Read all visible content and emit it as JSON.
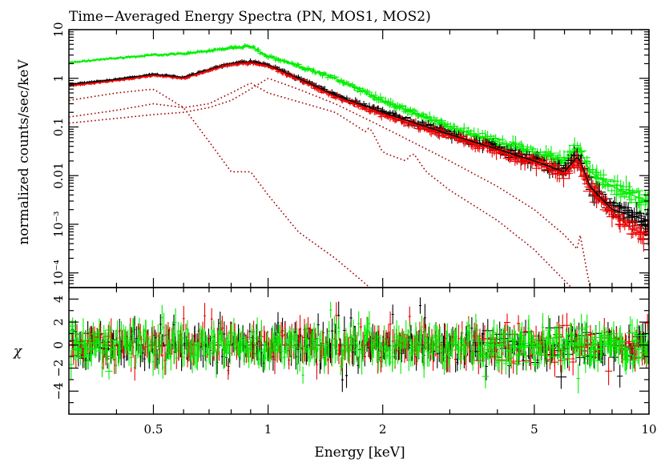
{
  "chart_data": [
    {
      "panel": "spectrum",
      "type": "scatter",
      "title": "Time−Averaged Energy Spectra (PN, MOS1, MOS2)",
      "xlabel": "Energy [keV]",
      "ylabel": "normalized counts/sec/keV",
      "xscale": "log",
      "yscale": "log",
      "xlim": [
        0.3,
        10
      ],
      "ylim": [
        5e-05,
        10
      ],
      "grid": false,
      "legend": "none",
      "x_ticks": [
        "0.5",
        "1",
        "2",
        "5",
        "10"
      ],
      "y_ticks": [
        "10⁻⁴",
        "10⁻³",
        "0.01",
        "0.1",
        "1",
        "10"
      ],
      "series": [
        {
          "color": "#00ee00",
          "style": "crosses",
          "x": [
            0.3,
            0.4,
            0.5,
            0.6,
            0.7,
            0.8,
            0.9,
            1.0,
            1.2,
            1.5,
            2.0,
            3.0,
            4.0,
            5.0,
            6.0,
            6.5,
            6.6,
            7.0,
            8.0,
            9.0,
            10.0
          ],
          "y": [
            2.1,
            2.6,
            3.0,
            3.2,
            3.7,
            4.3,
            4.6,
            2.8,
            1.8,
            1.0,
            0.35,
            0.1,
            0.05,
            0.03,
            0.02,
            0.04,
            0.035,
            0.012,
            0.006,
            0.004,
            0.003
          ]
        },
        {
          "color": "#000000",
          "style": "crosses",
          "x": [
            0.3,
            0.4,
            0.5,
            0.6,
            0.7,
            0.8,
            0.9,
            1.0,
            1.2,
            1.5,
            2.0,
            3.0,
            4.0,
            5.0,
            6.0,
            6.5,
            6.6,
            7.0,
            8.0,
            9.0,
            10.0
          ],
          "y": [
            0.75,
            0.95,
            1.2,
            1.05,
            1.5,
            2.0,
            2.2,
            1.9,
            1.0,
            0.45,
            0.2,
            0.07,
            0.035,
            0.02,
            0.012,
            0.025,
            0.02,
            0.006,
            0.002,
            0.0015,
            0.0012
          ]
        },
        {
          "color": "#ee0000",
          "style": "crosses",
          "x": [
            0.3,
            0.4,
            0.5,
            0.6,
            0.7,
            0.8,
            0.9,
            1.0,
            1.2,
            1.5,
            2.0,
            3.0,
            4.0,
            5.0,
            6.0,
            6.5,
            6.6,
            7.0,
            8.0,
            9.0,
            10.0
          ],
          "y": [
            0.7,
            0.9,
            1.15,
            1.0,
            1.45,
            1.95,
            2.1,
            1.8,
            0.95,
            0.42,
            0.18,
            0.065,
            0.032,
            0.018,
            0.011,
            0.022,
            0.018,
            0.005,
            0.0018,
            0.0008,
            0.0006
          ]
        },
        {
          "color": "#a80000",
          "style": "dotted",
          "component": 1,
          "x": [
            0.3,
            0.4,
            0.5,
            0.6,
            0.7,
            0.8,
            0.9,
            1.0,
            1.2,
            1.5,
            2.0,
            2.5
          ],
          "y": [
            0.35,
            0.5,
            0.6,
            0.25,
            0.05,
            0.012,
            0.012,
            0.004,
            0.0007,
            0.0002,
            3e-05,
            5e-06
          ]
        },
        {
          "color": "#a80000",
          "style": "dotted",
          "component": 2,
          "x": [
            0.3,
            0.4,
            0.5,
            0.6,
            0.7,
            0.8,
            0.9,
            1.0,
            1.5,
            1.8,
            1.85,
            2.0,
            2.3,
            2.4,
            2.6,
            3.0,
            4.0,
            5.0,
            6.0,
            7.0
          ],
          "y": [
            0.16,
            0.22,
            0.3,
            0.25,
            0.3,
            0.5,
            0.8,
            0.5,
            0.2,
            0.08,
            0.1,
            0.03,
            0.02,
            0.03,
            0.012,
            0.005,
            0.0012,
            0.0003,
            7e-05,
            2e-05
          ]
        },
        {
          "color": "#a80000",
          "style": "dotted",
          "component": 3,
          "x": [
            0.3,
            0.4,
            0.5,
            0.6,
            0.7,
            0.8,
            0.9,
            1.0,
            1.2,
            1.5,
            2.0,
            3.0,
            4.0,
            5.0,
            6.0,
            6.5,
            6.6,
            7.0
          ],
          "y": [
            0.12,
            0.15,
            0.18,
            0.2,
            0.25,
            0.35,
            0.6,
            1.0,
            0.6,
            0.3,
            0.1,
            0.02,
            0.006,
            0.002,
            0.0006,
            0.0003,
            0.0006,
            5e-05
          ]
        }
      ]
    },
    {
      "panel": "residuals",
      "type": "scatter",
      "xlabel": "Energy [keV]",
      "ylabel": "χ",
      "xscale": "log",
      "xlim": [
        0.3,
        10
      ],
      "ylim": [
        -6,
        5
      ],
      "grid": false,
      "legend": "none",
      "reference_line": 0,
      "x_ticks": [
        "0.5",
        "1",
        "2",
        "5",
        "10"
      ],
      "y_ticks": [
        "−4",
        "−2",
        "0",
        "2",
        "4"
      ],
      "series": [
        {
          "color": "#000000",
          "style": "crosses",
          "residual_range": [
            -5,
            4.3
          ]
        },
        {
          "color": "#ee0000",
          "style": "crosses",
          "residual_range": [
            -4,
            3.5
          ]
        },
        {
          "color": "#00ee00",
          "style": "crosses",
          "residual_range": [
            -5.5,
            3.5
          ]
        }
      ]
    }
  ]
}
